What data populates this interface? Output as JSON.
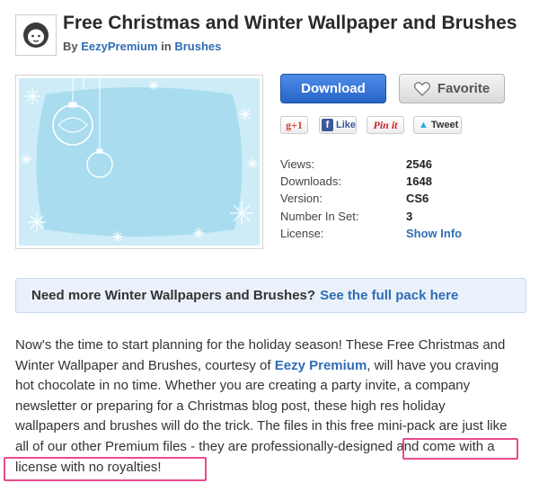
{
  "header": {
    "title": "Free Christmas and Winter Wallpaper and Brushes",
    "by_prefix": "By",
    "author": "EezyPremium",
    "in_word": "in",
    "category": "Brushes"
  },
  "actions": {
    "download_label": "Download",
    "favorite_label": "Favorite"
  },
  "share": {
    "gplus_label": "g+1",
    "like_label": "Like",
    "pin_label": "Pin it",
    "tweet_label": "Tweet"
  },
  "meta": {
    "views_label": "Views:",
    "views_value": "2546",
    "downloads_label": "Downloads:",
    "downloads_value": "1648",
    "version_label": "Version:",
    "version_value": "CS6",
    "set_label": "Number In Set:",
    "set_value": "3",
    "license_label": "License:",
    "license_link": "Show Info"
  },
  "callout": {
    "text": "Need more Winter Wallpapers and Brushes?",
    "link": "See the full pack here"
  },
  "description": {
    "line1": "Now's the time to start planning for the holiday season! These Free Christmas and",
    "line2_a": "Winter Wallpaper and Brushes, courtesy of ",
    "line2_link": "Eezy Premium",
    "line2_b": ", will have you craving",
    "line3": "hot chocolate in no time. Whether you are creating a party invite, a company",
    "line4": "newsletter or preparing for a Christmas blog post, these high res holiday",
    "line5": "wallpapers and brushes will do the trick. The files in this free mini-pack are just like",
    "line6": "all of our other Premium files - they are professionally-designed and come with a",
    "line7": "license with no royalties!"
  },
  "colors": {
    "link": "#2f6db5",
    "download_button": "#2864c8",
    "callout_bg": "#eaf1fa",
    "highlight": "#e94a8f",
    "preview_bg": "#a9dcef"
  }
}
